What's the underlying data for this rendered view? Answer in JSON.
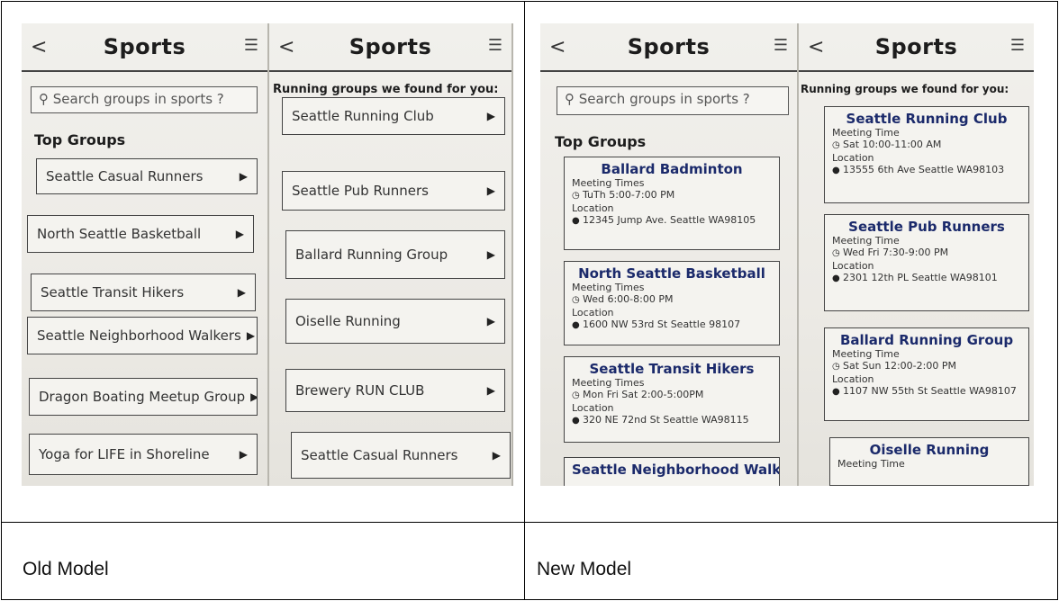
{
  "captions": {
    "left": "Old Model",
    "right": "New Model"
  },
  "old_model": {
    "screen_list": {
      "back": "<",
      "title": "Sports",
      "menu": "☰",
      "search_placeholder": "Search groups in sports ?",
      "section": "Top Groups",
      "items": [
        {
          "label": "Seattle Casual Runners"
        },
        {
          "label": "North Seattle Basketball"
        },
        {
          "label": "Seattle Transit Hikers"
        },
        {
          "label": "Seattle Neighborhood Walkers"
        },
        {
          "label": "Dragon Boating Meetup Group"
        },
        {
          "label": "Yoga for LIFE in Shoreline"
        }
      ]
    },
    "screen_results": {
      "back": "<",
      "title": "Sports",
      "menu": "☰",
      "heading": "Running groups we found for you:",
      "items": [
        {
          "label": "Seattle Running Club"
        },
        {
          "label": "Seattle Pub Runners"
        },
        {
          "label": "Ballard Running Group"
        },
        {
          "label": "Oiselle Running"
        },
        {
          "label": "Brewery RUN CLUB"
        },
        {
          "label": "Seattle Casual Runners"
        }
      ]
    }
  },
  "new_model": {
    "screen_list": {
      "back": "<",
      "title": "Sports",
      "menu": "☰",
      "search_placeholder": "Search groups in sports ?",
      "section": "Top Groups",
      "cards": [
        {
          "name": "Ballard Badminton",
          "label": "Meeting Times",
          "time": "TuTh 5:00-7:00 PM",
          "loc_label": "Location",
          "address": "12345 Jump Ave. Seattle WA98105"
        },
        {
          "name": "North Seattle Basketball",
          "label": "Meeting Times",
          "time": "Wed 6:00-8:00 PM",
          "loc_label": "Location",
          "address": "1600 NW 53rd St Seattle 98107"
        },
        {
          "name": "Seattle Transit Hikers",
          "label": "Meeting Times",
          "time": "Mon Fri Sat 2:00-5:00PM",
          "loc_label": "Location",
          "address": "320 NE 72nd St Seattle WA98115"
        },
        {
          "name": "Seattle Neighborhood Walkers"
        }
      ]
    },
    "screen_results": {
      "back": "<",
      "title": "Sports",
      "menu": "☰",
      "heading": "Running groups we found for you:",
      "cards": [
        {
          "name": "Seattle Running Club",
          "label": "Meeting Time",
          "time": "Sat 10:00-11:00 AM",
          "loc_label": "Location",
          "address": "13555 6th Ave Seattle WA98103"
        },
        {
          "name": "Seattle Pub Runners",
          "label": "Meeting Time",
          "time": "Wed Fri 7:30-9:00 PM",
          "loc_label": "Location",
          "address": "2301 12th PL Seattle WA98101"
        },
        {
          "name": "Ballard Running Group",
          "label": "Meeting Time",
          "time": "Sat Sun 12:00-2:00 PM",
          "loc_label": "Location",
          "address": "1107 NW 55th St Seattle WA98107"
        },
        {
          "name": "Oiselle Running",
          "label": "Meeting Time"
        }
      ]
    }
  },
  "icons": {
    "search": "search-icon",
    "arrow": "play-arrow-icon",
    "clock": "clock-icon",
    "pin": "location-pin-icon"
  }
}
